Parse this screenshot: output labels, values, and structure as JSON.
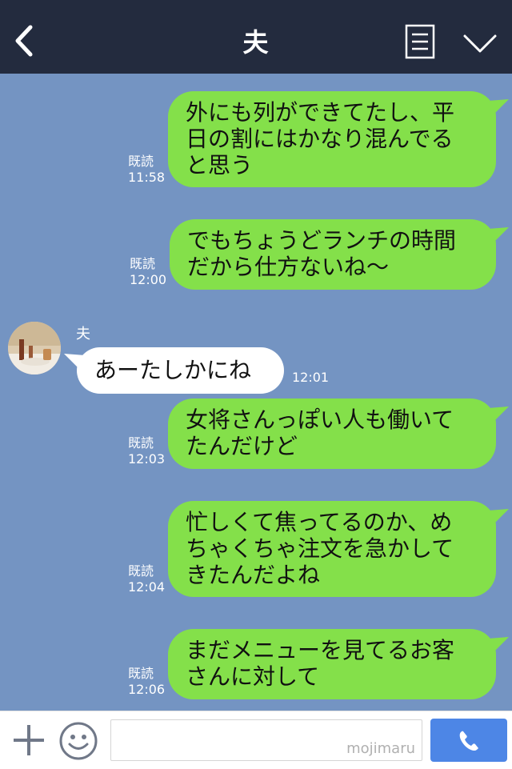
{
  "header": {
    "title": "夫"
  },
  "chat": {
    "messages": [
      {
        "lines": [
          "外にも列ができてたし、平",
          "日の割にはかなり混んでる",
          "と思う"
        ],
        "read": "既読",
        "time": "11:58"
      },
      {
        "lines": [
          "でもちょうどランチの時間",
          "だから仕方ないね〜"
        ],
        "read": "既読",
        "time": "12:00"
      },
      {
        "sender": "夫",
        "text": "あーたしかにね",
        "time": "12:01"
      },
      {
        "lines": [
          "女将さんっぽい人も働いて",
          "たんだけど"
        ],
        "read": "既読",
        "time": "12:03"
      },
      {
        "lines": [
          "忙しくて焦ってるのか、め",
          "ちゃくちゃ注文を急かして",
          "きたんだよね"
        ],
        "read": "既読",
        "time": "12:04"
      },
      {
        "lines": [
          "まだメニューを見てるお客",
          "さんに対して"
        ],
        "read": "既読",
        "time": "12:06"
      }
    ]
  },
  "footer": {
    "watermark": "mojimaru"
  },
  "icons": {
    "back": "chevron-left-icon",
    "menu": "note-icon",
    "dropdown": "chevron-down-icon",
    "plus": "plus-icon",
    "emoji": "smiley-icon",
    "call": "phone-icon",
    "avatar": "avatar-photo"
  },
  "colors": {
    "header_bg": "#232b3e",
    "chat_bg": "#7494c2",
    "outgoing_bubble": "#84e04a",
    "incoming_bubble": "#ffffff",
    "call_button": "#4d86e6"
  }
}
